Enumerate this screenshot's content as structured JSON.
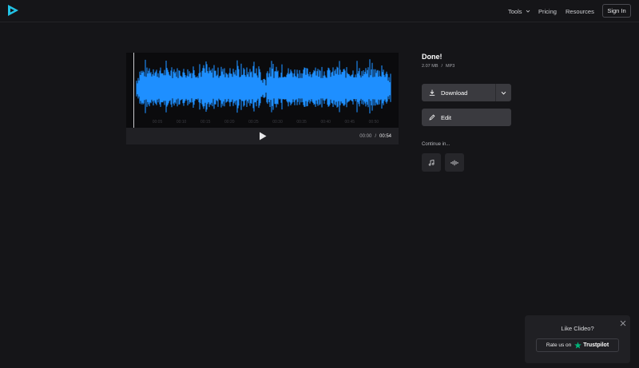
{
  "header": {
    "nav": {
      "tools_label": "Tools",
      "pricing_label": "Pricing",
      "resources_label": "Resources"
    },
    "signin_label": "Sign In"
  },
  "player": {
    "tick_labels": [
      "00:05",
      "00:10",
      "00:15",
      "00:20",
      "00:25",
      "00:30",
      "00:35",
      "00:40",
      "00:45",
      "00:50"
    ],
    "current_time": "00:00",
    "time_separator": "/",
    "duration": "00:54",
    "waveform_color": "#1e8fff"
  },
  "result": {
    "title": "Done!",
    "file_size": "2.07 MB",
    "meta_separator": "/",
    "file_format": "MP3",
    "download_label": "Download",
    "edit_label": "Edit",
    "continue_label": "Continue in..."
  },
  "continue_tools": [
    {
      "icon": "music-note-icon"
    },
    {
      "icon": "waveform-icon"
    }
  ],
  "toast": {
    "title": "Like Clideo?",
    "rate_label": "Rate us on",
    "brand_label": "Trustpilot",
    "star_color": "#00b67a"
  },
  "colors": {
    "background": "#151518",
    "accent": "#1e8fff",
    "logo": "#22c3e6"
  }
}
